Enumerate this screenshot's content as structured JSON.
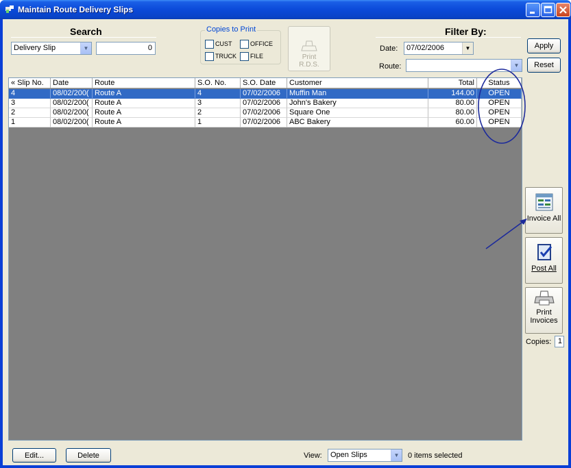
{
  "window": {
    "title": "Maintain Route Delivery Slips"
  },
  "search": {
    "heading": "Search",
    "field": "Delivery Slip",
    "value": "0"
  },
  "copies": {
    "legend": "Copies to Print",
    "cust": "CUST",
    "office": "OFFICE",
    "truck": "TRUCK",
    "file": "FILE"
  },
  "print_rds": {
    "line1": "Print",
    "line2": "R.D.S."
  },
  "filter": {
    "heading": "Filter By:",
    "date_label": "Date:",
    "date_value": "07/02/2006",
    "route_label": "Route:",
    "route_value": ""
  },
  "buttons": {
    "apply": "Apply",
    "reset": "Reset",
    "edit": "Edit...",
    "delete": "Delete"
  },
  "table": {
    "columns": [
      "« Slip No.",
      "Date",
      "Route",
      "S.O. No.",
      "S.O. Date",
      "Customer",
      "Total",
      "Status"
    ],
    "rows": [
      [
        "4",
        "08/02/200(",
        "Route A",
        "4",
        "07/02/2006",
        "Muffin Man",
        "144.00",
        "OPEN"
      ],
      [
        "3",
        "08/02/200(",
        "Route A",
        "3",
        "07/02/2006",
        "John's Bakery",
        "80.00",
        "OPEN"
      ],
      [
        "2",
        "08/02/200(",
        "Route A",
        "2",
        "07/02/2006",
        "Square One",
        "80.00",
        "OPEN"
      ],
      [
        "1",
        "08/02/200(",
        "Route A",
        "1",
        "07/02/2006",
        "ABC Bakery",
        "60.00",
        "OPEN"
      ]
    ]
  },
  "side": {
    "invoice_all": "Invoice All",
    "post_all": "Post All",
    "print_invoices_1": "Print",
    "print_invoices_2": "Invoices",
    "copies_label": "Copies:",
    "copies_value": "1"
  },
  "footer": {
    "view_label": "View:",
    "view_value": "Open Slips",
    "status": "0 items selected"
  },
  "colors": {
    "selection": "#316ac5",
    "annotation": "#1c2a9b",
    "grid_bg": "#808080",
    "title_bar": "#0b4ad9"
  }
}
